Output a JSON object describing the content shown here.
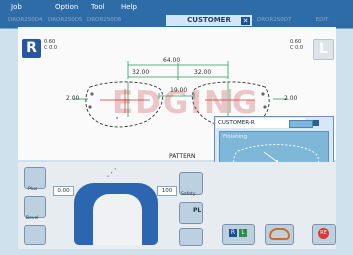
{
  "menu": {
    "items": [
      "Job",
      "Option",
      "Tool",
      "Help"
    ]
  },
  "tabs": {
    "items": [
      {
        "label": "DROR2S0D4"
      },
      {
        "label": "DROR2S0D5"
      },
      {
        "label": "DROR2S0D6"
      },
      {
        "label": "CUSTOMER"
      },
      {
        "label": "DROR2S0D7"
      },
      {
        "label": "EDIT"
      }
    ],
    "active": "CUSTOMER",
    "close_glyph": "✕"
  },
  "lens_view": {
    "right_badge": "R",
    "left_badge": "L",
    "right_info": [
      "0.60",
      "C 0.0"
    ],
    "left_info": [
      "0.60",
      "C 0.0"
    ],
    "dimensions": {
      "total_width": "64.00",
      "half_left": "32.00",
      "half_right": "32.00",
      "dbl": "19.00",
      "left_margin": "2.00",
      "right_margin": "2.00"
    },
    "pattern_label": "PATTERN",
    "watermark": "EDGING"
  },
  "customer_panel": {
    "title": "CUSTOMER-R",
    "finishing_label": "Finishing"
  },
  "toolbar": {
    "plus_label": "Plus",
    "bevel_label": "Bevel",
    "value_left": "0.00",
    "value_right": "100",
    "safety_label": "Safety",
    "pl_label": "PL",
    "rl_r": "R",
    "rl_l": "L",
    "start_label": "RE"
  },
  "colors": {
    "header": "#2d6ca7",
    "accent": "#2b5ea8",
    "lens_line": "#2b9a5b",
    "panel": "#7fb7d9",
    "start": "#d73b3b"
  }
}
